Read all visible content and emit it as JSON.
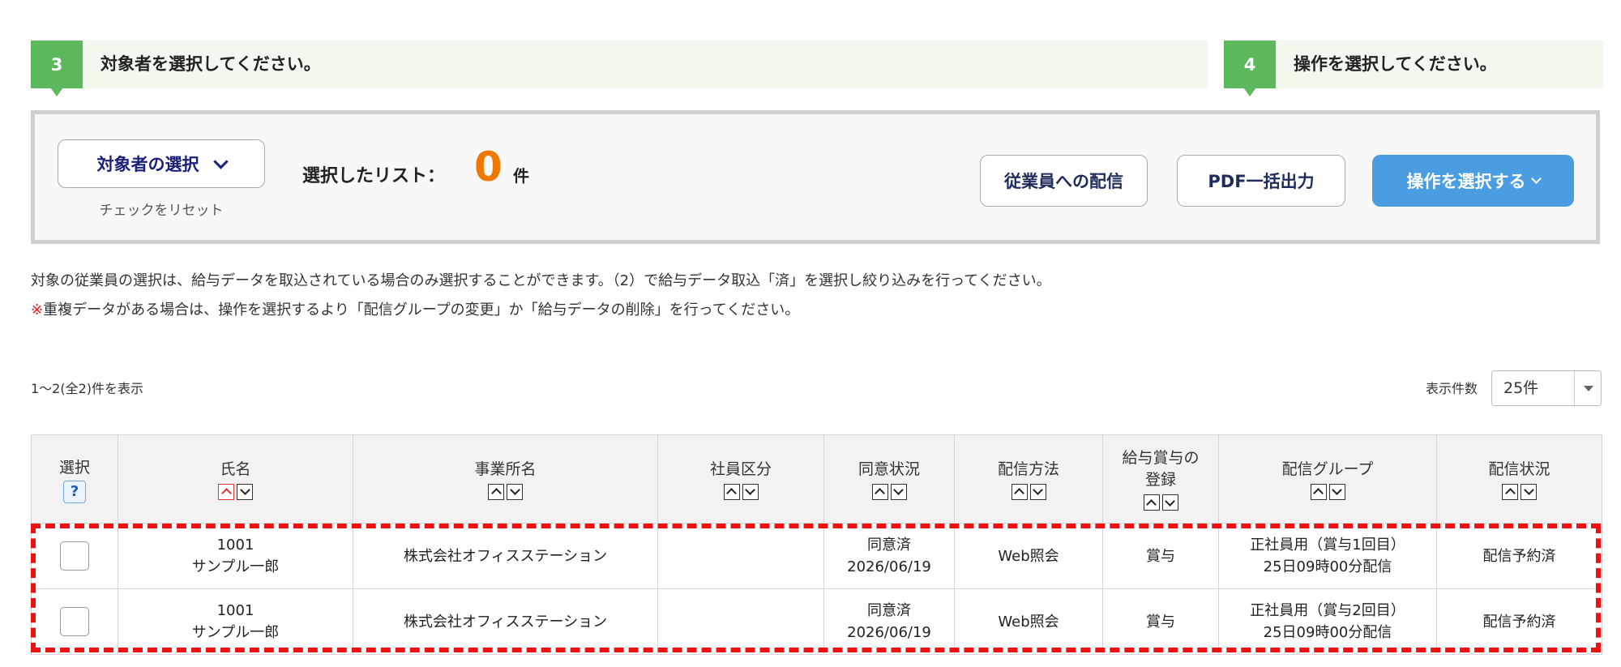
{
  "steps": [
    {
      "num": "3",
      "text": "対象者を選択してください。"
    },
    {
      "num": "4",
      "text": "操作を選択してください。"
    }
  ],
  "panel": {
    "select_target_label": "対象者の選択",
    "reset_label": "チェックをリセット",
    "selected_list_label": "選択したリスト：",
    "selected_count": "0",
    "count_unit": "件",
    "distribute_button": "従業員への配信",
    "pdf_button": "PDF一括出力",
    "operation_button": "操作を選択する"
  },
  "notes": {
    "line1": "対象の従業員の選択は、給与データを取込されている場合のみ選択することができます。（2）で給与データ取込「済」を選択し絞り込みを行ってください。",
    "line2_mark": "※",
    "line2": "重複データがある場合は、操作を選択するより「配信グループの変更」か「給与データの削除」を行ってください。"
  },
  "list_info": {
    "range_text": "1〜2(全2)件を表示",
    "per_page_label": "表示件数",
    "per_page_value": "25件"
  },
  "table": {
    "headers": {
      "select": "選択",
      "help": "?",
      "name": "氏名",
      "office": "事業所名",
      "employee_type": "社員区分",
      "consent": "同意状況",
      "method": "配信方法",
      "pay_type_line1": "給与賞与の",
      "pay_type_line2": "登録",
      "group": "配信グループ",
      "status": "配信状況"
    },
    "rows": [
      {
        "id": "1001",
        "name": "サンプル一郎",
        "office": "株式会社オフィスステーション",
        "employee_type": "",
        "consent": "同意済",
        "consent_date": "2026/06/19",
        "method": "Web照会",
        "pay_type": "賞与",
        "group_line1": "正社員用（賞与1回目）",
        "group_line2": "25日09時00分配信",
        "status": "配信予約済"
      },
      {
        "id": "1001",
        "name": "サンプル一郎",
        "office": "株式会社オフィスステーション",
        "employee_type": "",
        "consent": "同意済",
        "consent_date": "2026/06/19",
        "method": "Web照会",
        "pay_type": "賞与",
        "group_line1": "正社員用（賞与2回目）",
        "group_line2": "25日09時00分配信",
        "status": "配信予約済"
      }
    ]
  },
  "colors": {
    "step_green": "#5cb85c",
    "primary_blue": "#4a9de0",
    "count_orange": "#f07800",
    "highlight_red": "#ee1111"
  }
}
